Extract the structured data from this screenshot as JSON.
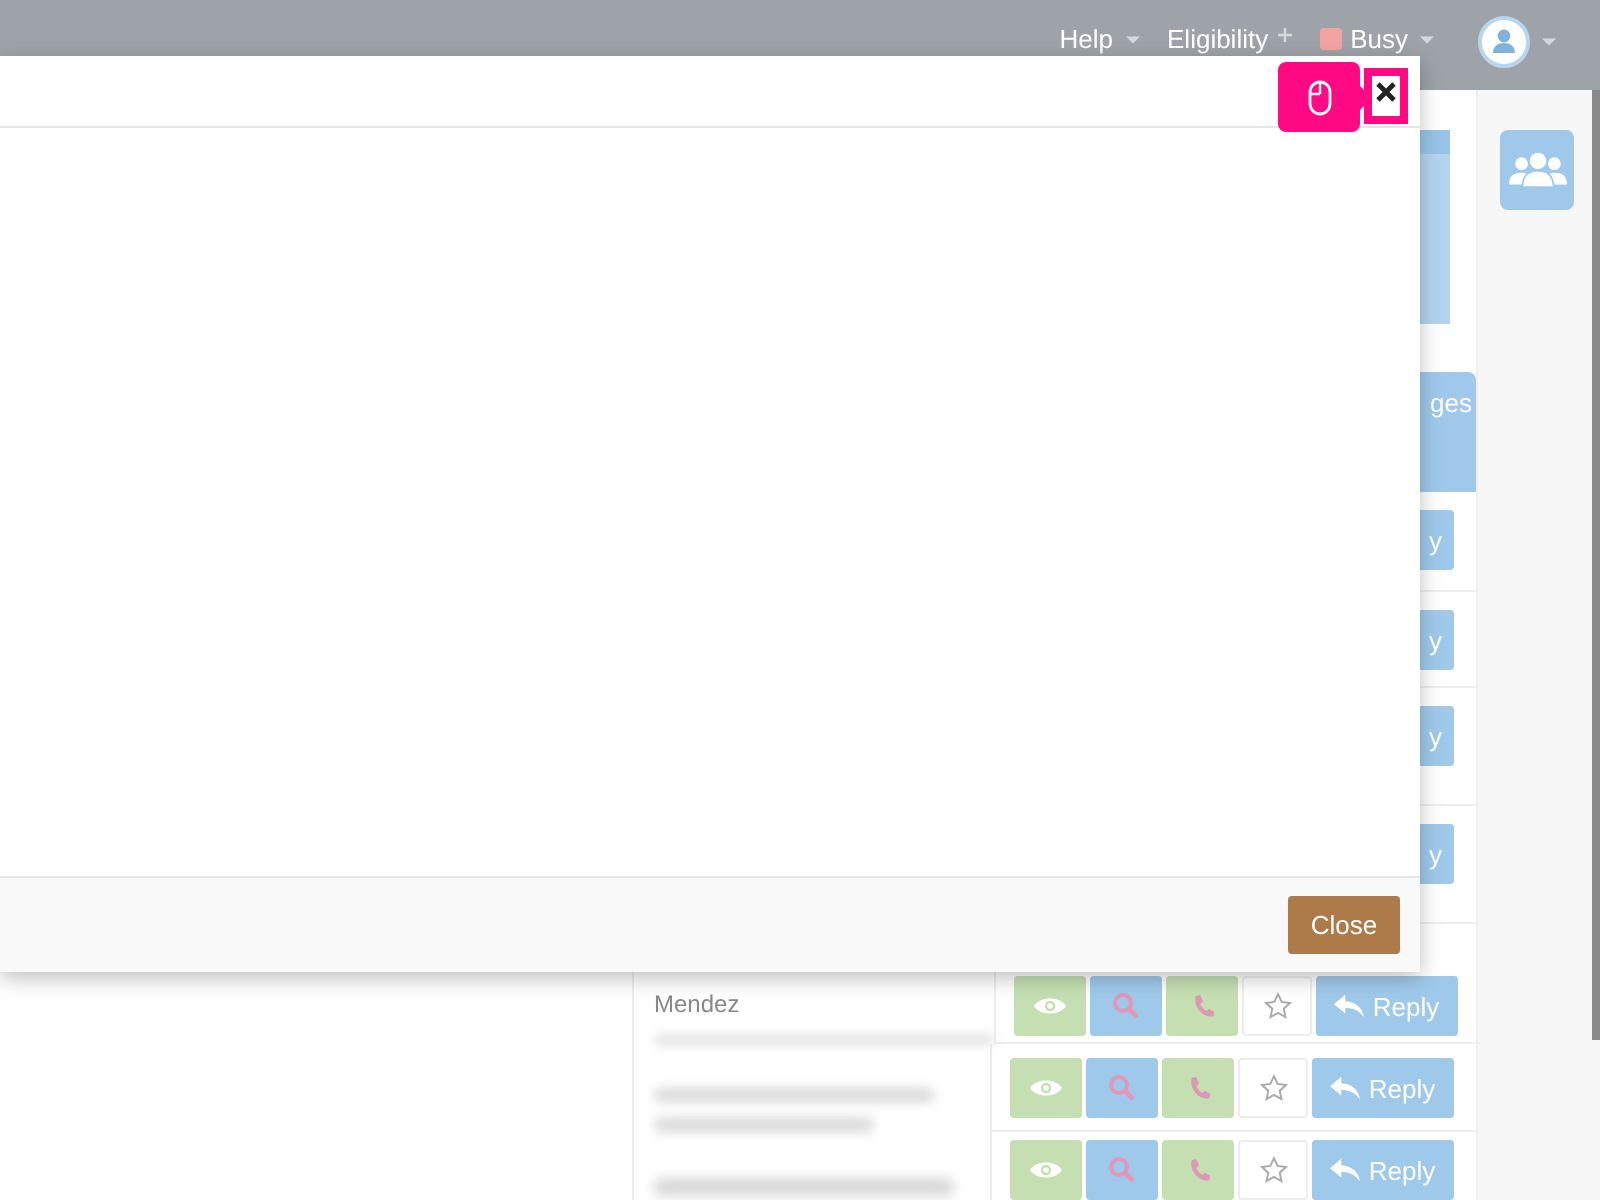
{
  "topbar": {
    "items": [
      {
        "kind": "menu",
        "label": "Help"
      },
      {
        "kind": "plus",
        "label": "Eligibility"
      },
      {
        "kind": "status",
        "label": "Busy",
        "color": "#f4a3a3"
      },
      {
        "kind": "avatar"
      }
    ]
  },
  "table": {
    "header": "ges",
    "rows": [
      {
        "kind": "covered",
        "reply": "y"
      },
      {
        "kind": "covered",
        "reply": "y"
      },
      {
        "kind": "covered",
        "reply": "y"
      },
      {
        "kind": "covered",
        "reply": "y"
      },
      {
        "kind": "full",
        "name": "Mendez",
        "starred": false,
        "reply": "Reply"
      },
      {
        "kind": "full",
        "starred": false,
        "reply": "Reply"
      },
      {
        "kind": "full",
        "starred": false,
        "reply": "Reply"
      }
    ]
  },
  "modal": {
    "close_button": "Close"
  }
}
